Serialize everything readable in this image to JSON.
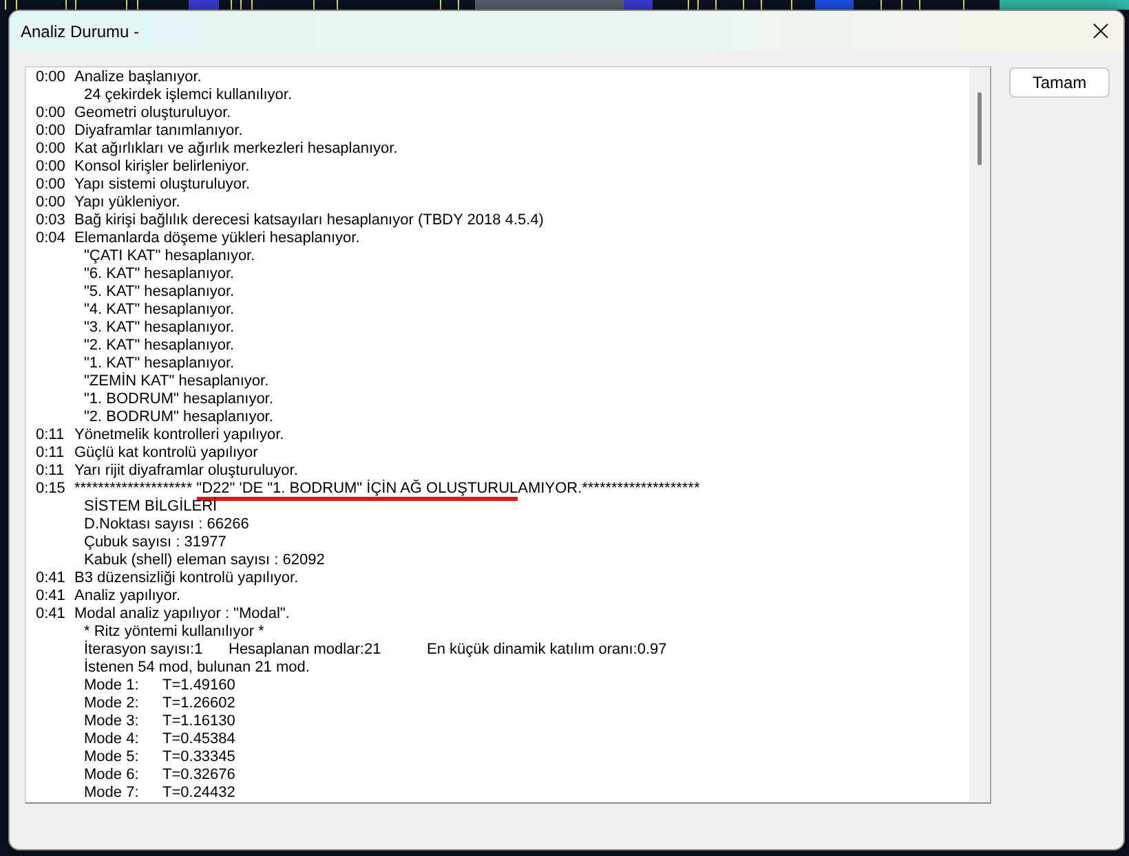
{
  "window": {
    "title": "Analiz Durumu -"
  },
  "log": {
    "lines": [
      {
        "kind": "timed",
        "time": "0:00",
        "text": "Analize başlanıyor."
      },
      {
        "kind": "detail",
        "text": "24 çekirdek işlemci kullanılıyor."
      },
      {
        "kind": "timed",
        "time": "0:00",
        "text": "Geometri oluşturuluyor."
      },
      {
        "kind": "timed",
        "time": "0:00",
        "text": "Diyaframlar tanımlanıyor."
      },
      {
        "kind": "timed",
        "time": "0:00",
        "text": "Kat ağırlıkları ve ağırlık merkezleri hesaplanıyor."
      },
      {
        "kind": "timed",
        "time": "0:00",
        "text": "Konsol kirişler belirleniyor."
      },
      {
        "kind": "timed",
        "time": "0:00",
        "text": "Yapı sistemi oluşturuluyor."
      },
      {
        "kind": "timed",
        "time": "0:00",
        "text": "Yapı yükleniyor."
      },
      {
        "kind": "timed",
        "time": "0:03",
        "text": "Bağ kirişi bağlılık derecesi katsayıları hesaplanıyor (TBDY 2018 4.5.4)"
      },
      {
        "kind": "timed",
        "time": "0:04",
        "text": "Elemanlarda döşeme yükleri hesaplanıyor."
      },
      {
        "kind": "detail",
        "text": "\"ÇATI KAT\" hesaplanıyor."
      },
      {
        "kind": "detail",
        "text": "\"6. KAT\" hesaplanıyor."
      },
      {
        "kind": "detail",
        "text": "\"5. KAT\" hesaplanıyor."
      },
      {
        "kind": "detail",
        "text": "\"4. KAT\" hesaplanıyor."
      },
      {
        "kind": "detail",
        "text": "\"3. KAT\" hesaplanıyor."
      },
      {
        "kind": "detail",
        "text": "\"2. KAT\" hesaplanıyor."
      },
      {
        "kind": "detail",
        "text": "\"1. KAT\" hesaplanıyor."
      },
      {
        "kind": "detail",
        "text": "\"ZEMİN KAT\" hesaplanıyor."
      },
      {
        "kind": "detail",
        "text": "\"1. BODRUM\" hesaplanıyor."
      },
      {
        "kind": "detail",
        "text": "\"2. BODRUM\" hesaplanıyor."
      },
      {
        "kind": "timed",
        "time": "0:11",
        "text": "Yönetmelik kontrolleri yapılıyor."
      },
      {
        "kind": "timed",
        "time": "0:11",
        "text": "Güçlü kat kontrolü yapılıyor"
      },
      {
        "kind": "timed",
        "time": "0:11",
        "text": "Yarı rijit diyaframlar oluşturuluyor."
      },
      {
        "kind": "timed",
        "time": "0:15",
        "segments": [
          {
            "text": "******************** ",
            "underlined": false
          },
          {
            "text": "\"D22\" 'DE \"1. BODRUM\" İÇİN AĞ OLUŞTURUL",
            "underlined": true
          },
          {
            "text": "AMIYOR.********************",
            "underlined": false
          }
        ]
      },
      {
        "kind": "detail",
        "text": "SİSTEM BİLGİLERİ"
      },
      {
        "kind": "detail",
        "text": "D.Noktası sayısı : 66266"
      },
      {
        "kind": "detail",
        "text": "Çubuk sayısı : 31977"
      },
      {
        "kind": "detail",
        "text": "Kabuk (shell) eleman sayısı : 62092"
      },
      {
        "kind": "timed",
        "time": "0:41",
        "text": "B3 düzensizliği kontrolü yapılıyor."
      },
      {
        "kind": "timed",
        "time": "0:41",
        "text": "Analiz yapılıyor."
      },
      {
        "kind": "timed",
        "time": "0:41",
        "text": "Modal analiz yapılıyor : \"Modal\"."
      },
      {
        "kind": "detail",
        "text": "* Ritz yöntemi kullanılıyor *"
      },
      {
        "kind": "columns",
        "parts": [
          "İterasyon sayısı:1",
          "Hesaplanan modlar:21",
          "En küçük dinamik katılım oranı:0.97"
        ]
      },
      {
        "kind": "detail",
        "text": "İstenen 54 mod, bulunan 21 mod."
      },
      {
        "kind": "columns",
        "parts": [
          "Mode 1:",
          "T=1.49160"
        ]
      },
      {
        "kind": "columns",
        "parts": [
          "Mode 2:",
          "T=1.26602"
        ]
      },
      {
        "kind": "columns",
        "parts": [
          "Mode 3:",
          "T=1.16130"
        ]
      },
      {
        "kind": "columns",
        "parts": [
          "Mode 4:",
          "T=0.45384"
        ]
      },
      {
        "kind": "columns",
        "parts": [
          "Mode 5:",
          "T=0.33345"
        ]
      },
      {
        "kind": "columns",
        "parts": [
          "Mode 6:",
          "T=0.32676"
        ]
      },
      {
        "kind": "columns",
        "parts": [
          "Mode 7:",
          "T=0.24432"
        ]
      }
    ]
  },
  "buttons": [
    {
      "label": "Tamam"
    }
  ]
}
